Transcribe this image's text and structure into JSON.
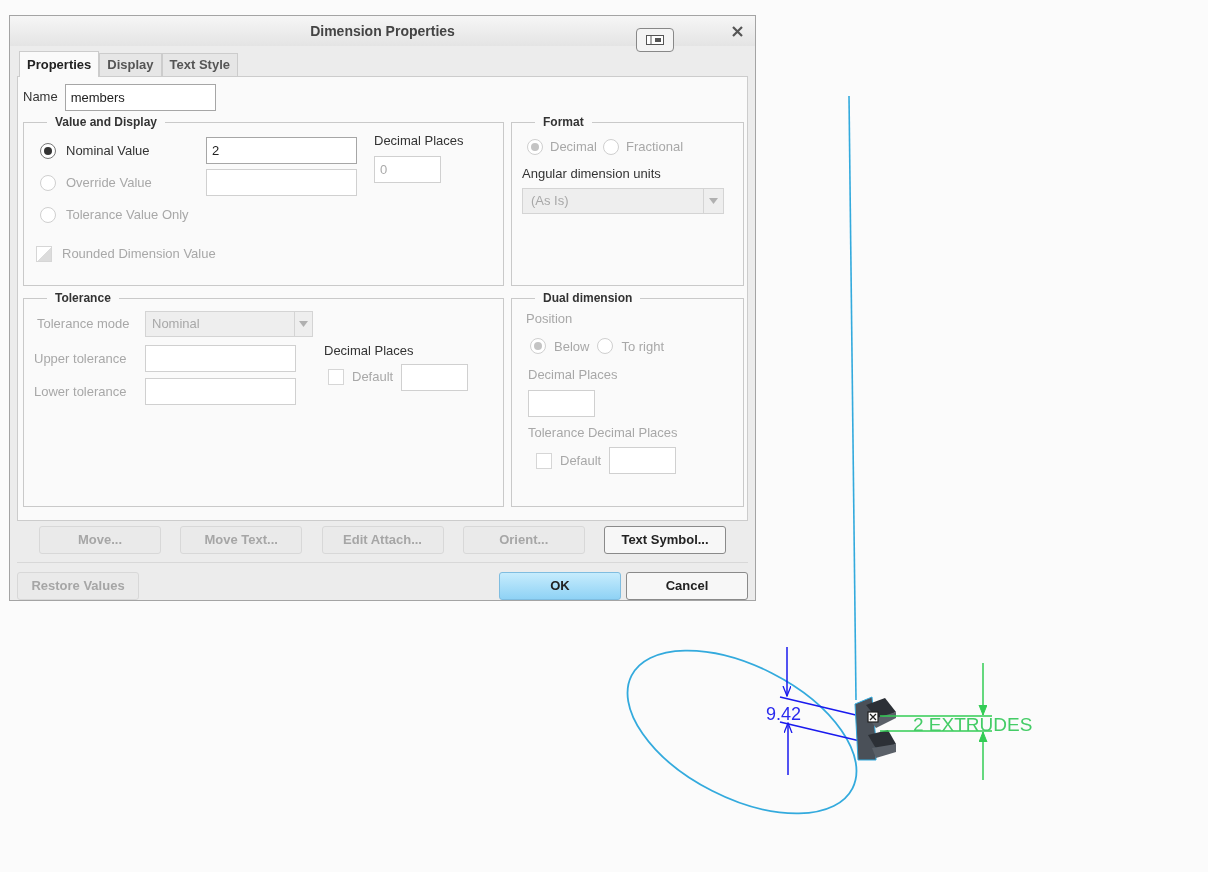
{
  "dialog": {
    "title": "Dimension Properties"
  },
  "tabs": [
    {
      "label": "Properties",
      "selected": true
    },
    {
      "label": "Display",
      "selected": false
    },
    {
      "label": "Text Style",
      "selected": false
    }
  ],
  "name": {
    "label": "Name",
    "value": "members"
  },
  "value_and_display": {
    "title": "Value and Display",
    "options": [
      {
        "label": "Nominal Value",
        "selected": true,
        "disabled": false,
        "value": "2"
      },
      {
        "label": "Override Value",
        "selected": false,
        "disabled": true
      },
      {
        "label": "Tolerance Value Only",
        "selected": false,
        "disabled": true
      }
    ],
    "decimal_places": {
      "label": "Decimal Places",
      "value": "0",
      "disabled": true
    },
    "rounded": {
      "label": "Rounded Dimension Value",
      "checked": false,
      "disabled": true
    }
  },
  "format": {
    "title": "Format",
    "disabled": true,
    "options": [
      {
        "label": "Decimal",
        "selected": true
      },
      {
        "label": "Fractional",
        "selected": false
      }
    ],
    "units_label": "Angular dimension units",
    "units_value": "(As Is)"
  },
  "tolerance": {
    "title": "Tolerance",
    "disabled": true,
    "mode_label": "Tolerance mode",
    "mode_value": "Nominal",
    "upper_label": "Upper tolerance",
    "lower_label": "Lower tolerance",
    "decimal_places_label": "Decimal Places",
    "default_label": "Default",
    "default_checked": false
  },
  "dual_dimension": {
    "title": "Dual dimension",
    "disabled": true,
    "position_label": "Position",
    "options": [
      {
        "label": "Below",
        "selected": true
      },
      {
        "label": "To right",
        "selected": false
      }
    ],
    "decimal_places_label": "Decimal Places",
    "tolerance_decimal_label": "Tolerance Decimal Places",
    "default_label": "Default",
    "default_checked": false
  },
  "action_buttons": [
    {
      "label": "Move...",
      "disabled": true
    },
    {
      "label": "Move Text...",
      "disabled": true
    },
    {
      "label": "Edit Attach...",
      "disabled": true
    },
    {
      "label": "Orient...",
      "disabled": true
    },
    {
      "label": "Text Symbol...",
      "disabled": false
    }
  ],
  "footer_buttons": [
    {
      "label": "Restore Values",
      "disabled": true,
      "kind": "normal"
    },
    {
      "label": "OK",
      "disabled": false,
      "kind": "primary"
    },
    {
      "label": "Cancel",
      "disabled": false,
      "kind": "normal"
    }
  ],
  "canvas": {
    "dimension_value": "9.42",
    "note": "2 EXTRUDES"
  }
}
